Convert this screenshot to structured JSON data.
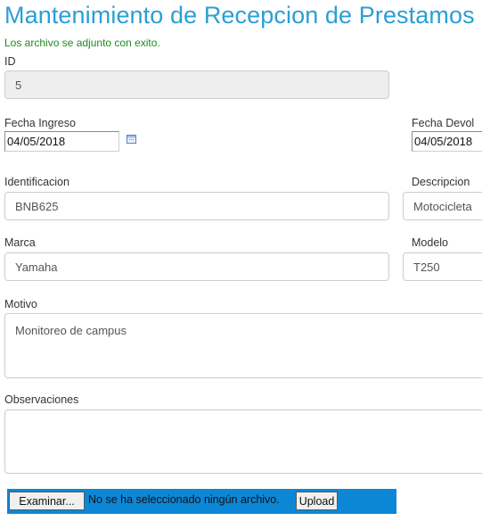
{
  "page": {
    "title": "Mantenimiento de Recepcion de Prestamos",
    "success_message": "Los archivo se adjunto con exito."
  },
  "form": {
    "id": {
      "label": "ID",
      "value": "5"
    },
    "fecha_ingreso": {
      "label": "Fecha Ingreso",
      "value": "04/05/2018",
      "icon": "calendar-icon"
    },
    "fecha_devolucion": {
      "label": "Fecha Devol",
      "value": "04/05/2018"
    },
    "identificacion": {
      "label": "Identificacion",
      "value": "BNB625"
    },
    "descripcion": {
      "label": "Descripcion",
      "value": "Motocicleta"
    },
    "marca": {
      "label": "Marca",
      "value": "Yamaha"
    },
    "modelo": {
      "label": "Modelo",
      "value": "T250"
    },
    "motivo": {
      "label": "Motivo",
      "value": "Monitoreo de campus"
    },
    "observaciones": {
      "label": "Observaciones",
      "value": ""
    }
  },
  "upload": {
    "browse_label": "Examinar...",
    "file_status": "No se ha seleccionado ningún archivo.",
    "upload_label": "Upload",
    "bar_color": "#0c87d6"
  },
  "colors": {
    "title": "#2a9fd6",
    "success": "#1e8a1e",
    "disabled_bg": "#eeeeee"
  }
}
